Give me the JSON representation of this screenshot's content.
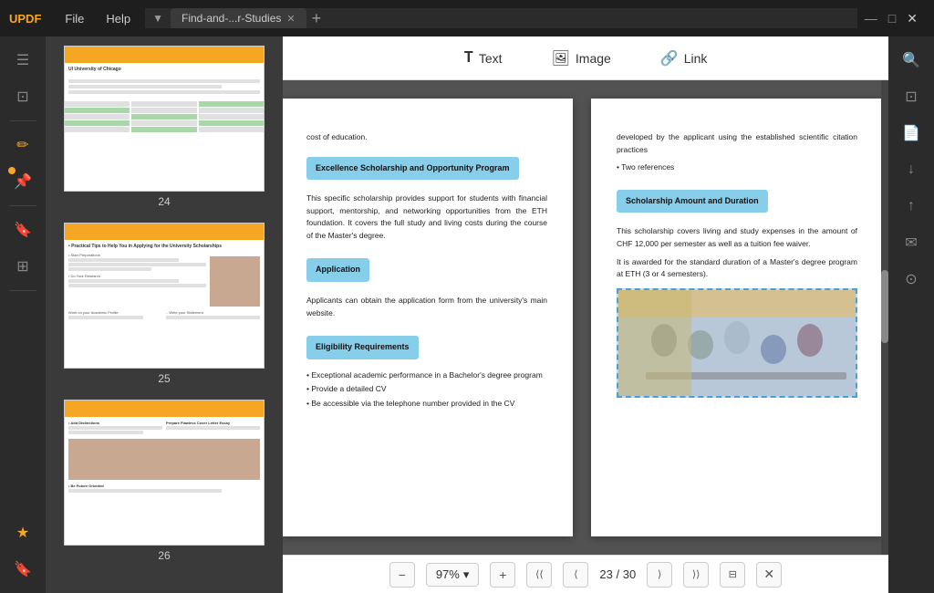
{
  "app": {
    "logo": "UPDF",
    "menu": [
      "File",
      "Help"
    ],
    "tab": {
      "label": "Find-and-...r-Studies",
      "arrow": "▼"
    },
    "add_tab": "+",
    "window_controls": [
      "—",
      "□",
      "✕"
    ],
    "chevron": "V"
  },
  "toolbar": {
    "text_label": "Text",
    "image_label": "Image",
    "link_label": "Link"
  },
  "left_sidebar": {
    "icons": [
      "☰",
      "⊡",
      "✏",
      "🔖",
      "⊞",
      "↑",
      "✉",
      "⊙"
    ]
  },
  "right_sidebar": {
    "icons": [
      "🔍",
      "⊡",
      "📄",
      "↓",
      "↑",
      "✉",
      "⊙"
    ]
  },
  "page_left": {
    "intro_text": "cost of education.",
    "section1_label": "Excellence Scholarship and Opportunity Program",
    "section1_body": "This specific scholarship provides support for students with financial support, mentorship, and networking opportunities from the ETH foundation. It covers the full study and living costs during the course of the Master's degree.",
    "section2_label": "Application",
    "section2_body": "Applicants can obtain the application form from the university's main website.",
    "section3_label": "Eligibility Requirements",
    "eligibility": [
      "• Exceptional academic performance in a Bachelor's degree program",
      "• Provide a detailed CV",
      "• Be accessible via the telephone number provided in the CV"
    ]
  },
  "page_right": {
    "bullet1": "developed by the applicant using the established scientific citation practices",
    "bullet2": "• Two references",
    "section1_label": "Scholarship Amount and Duration",
    "section1_body1": "This scholarship covers living and study expenses in the amount of CHF 12,000 per semester as well as a tuition fee waiver.",
    "section1_body2": "It is awarded for the standard duration of a Master's degree program at ETH (3 or 4 semesters)."
  },
  "bottom_bar": {
    "zoom_out": "−",
    "zoom_level": "97%",
    "zoom_dropdown": "▾",
    "zoom_in": "+",
    "nav_first": "⟨⟨",
    "nav_prev": "⟨",
    "page_current": "23",
    "page_sep": "/",
    "page_total": "30",
    "nav_next": "⟩",
    "nav_last": "⟩⟩",
    "fit_page": "⊟",
    "close": "✕"
  },
  "thumbnails": [
    {
      "num": "24"
    },
    {
      "num": "25"
    },
    {
      "num": "26"
    }
  ]
}
